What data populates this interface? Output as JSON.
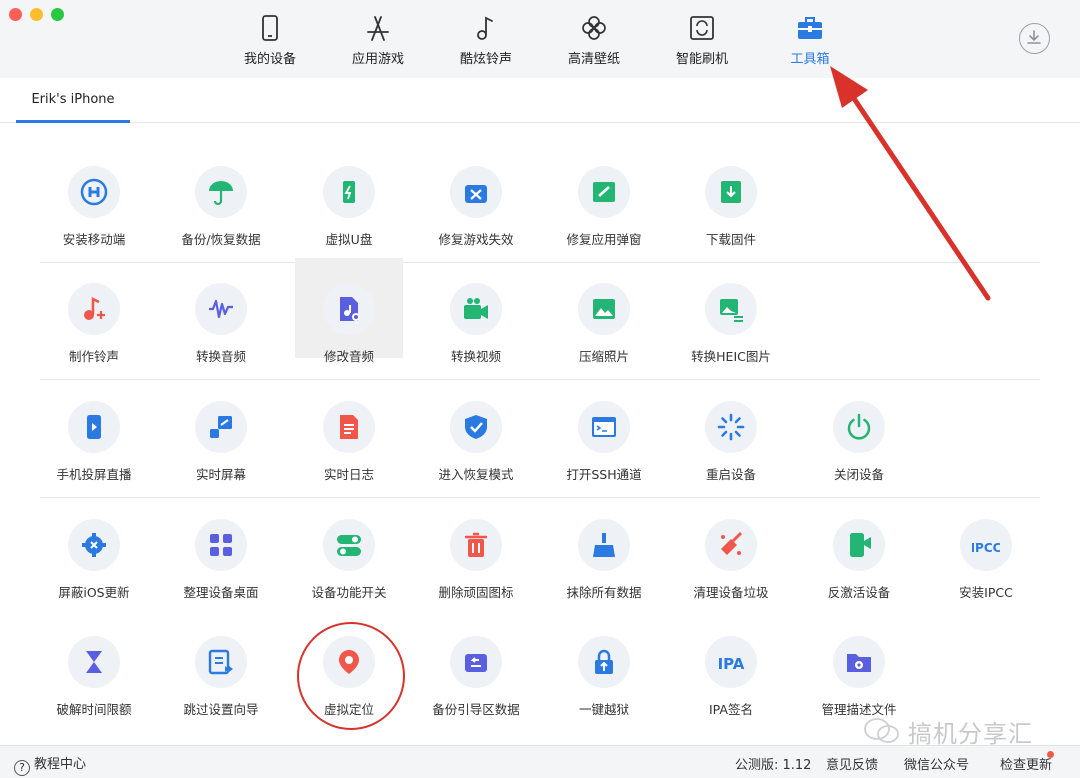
{
  "nav": {
    "items": [
      {
        "label": "我的设备",
        "icon": "phone-icon"
      },
      {
        "label": "应用游戏",
        "icon": "app-store-icon"
      },
      {
        "label": "酷炫铃声",
        "icon": "music-note-icon"
      },
      {
        "label": "高清壁纸",
        "icon": "flower-icon"
      },
      {
        "label": "智能刷机",
        "icon": "refresh-device-icon"
      },
      {
        "label": "工具箱",
        "icon": "toolbox-icon"
      }
    ],
    "active": "工具箱"
  },
  "device_tab": "Erik's iPhone",
  "tools": [
    {
      "label": "安装移动端",
      "icon": "install-mobile-icon",
      "color": "#2a7ae2"
    },
    {
      "label": "备份/恢复数据",
      "icon": "umbrella-icon",
      "color": "#22b573"
    },
    {
      "label": "虚拟U盘",
      "icon": "usb-drive-icon",
      "color": "#22b573"
    },
    {
      "label": "修复游戏失效",
      "icon": "repair-game-icon",
      "color": "#2a7ae2"
    },
    {
      "label": "修复应用弹窗",
      "icon": "repair-popup-icon",
      "color": "#22b573"
    },
    {
      "label": "下载固件",
      "icon": "download-firmware-icon",
      "color": "#22b573"
    },
    {
      "label": "制作铃声",
      "icon": "ringtone-icon",
      "color": "#f0564a"
    },
    {
      "label": "转换音频",
      "icon": "waveform-icon",
      "color": "#5a5fe0"
    },
    {
      "label": "修改音频",
      "icon": "edit-audio-icon",
      "color": "#5a5fe0"
    },
    {
      "label": "转换视频",
      "icon": "video-icon",
      "color": "#22b573"
    },
    {
      "label": "压缩照片",
      "icon": "photo-icon",
      "color": "#22b573"
    },
    {
      "label": "转换HEIC图片",
      "icon": "heic-image-icon",
      "color": "#22b573"
    },
    {
      "label": "手机投屏直播",
      "icon": "screen-mirror-icon",
      "color": "#2a7ae2"
    },
    {
      "label": "实时屏幕",
      "icon": "realtime-screen-icon",
      "color": "#2a7ae2"
    },
    {
      "label": "实时日志",
      "icon": "log-icon",
      "color": "#f0564a"
    },
    {
      "label": "进入恢复模式",
      "icon": "shield-check-icon",
      "color": "#2a7ae2"
    },
    {
      "label": "打开SSH通道",
      "icon": "terminal-icon",
      "color": "#2a7ae2"
    },
    {
      "label": "重启设备",
      "icon": "restart-spinner-icon",
      "color": "#2a7ae2"
    },
    {
      "label": "关闭设备",
      "icon": "power-icon",
      "color": "#22b573"
    },
    {
      "label": "屏蔽iOS更新",
      "icon": "block-update-gear-icon",
      "color": "#2a7ae2"
    },
    {
      "label": "整理设备桌面",
      "icon": "grid-icon",
      "color": "#5a5fe0"
    },
    {
      "label": "设备功能开关",
      "icon": "toggle-icon",
      "color": "#22b573"
    },
    {
      "label": "删除顽固图标",
      "icon": "trash-icon",
      "color": "#f0564a"
    },
    {
      "label": "抹除所有数据",
      "icon": "broom-icon",
      "color": "#2a7ae2"
    },
    {
      "label": "清理设备垃圾",
      "icon": "cleaner-icon",
      "color": "#f0564a"
    },
    {
      "label": "反激活设备",
      "icon": "deactivate-device-icon",
      "color": "#22b573"
    },
    {
      "label": "安装IPCC",
      "icon": "ipcc-icon",
      "color": "#2a7ae2",
      "text": "IPCC"
    },
    {
      "label": "破解时间限额",
      "icon": "hourglass-icon",
      "color": "#5a5fe0"
    },
    {
      "label": "跳过设置向导",
      "icon": "skip-setup-icon",
      "color": "#2a7ae2"
    },
    {
      "label": "虚拟定位",
      "icon": "location-pin-icon",
      "color": "#f0564a"
    },
    {
      "label": "备份引导区数据",
      "icon": "backup-boot-icon",
      "color": "#5a5fe0"
    },
    {
      "label": "一键越狱",
      "icon": "jailbreak-lock-icon",
      "color": "#2a7ae2"
    },
    {
      "label": "IPA签名",
      "icon": "ipa-icon",
      "color": "#2a7ae2",
      "text": "IPA"
    },
    {
      "label": "管理描述文件",
      "icon": "profile-folder-icon",
      "color": "#5a5fe0"
    }
  ],
  "highlighted_tool": "修改音频",
  "annotated_tool": "虚拟定位",
  "watermark": "搞机分享汇",
  "status": {
    "help": "教程中心",
    "version": "公测版: 1.12",
    "feedback": "意见反馈",
    "wechat": "微信公众号",
    "update": "检查更新"
  },
  "colors": {
    "accent": "#2a7ae2",
    "annotation": "#d8322b"
  }
}
